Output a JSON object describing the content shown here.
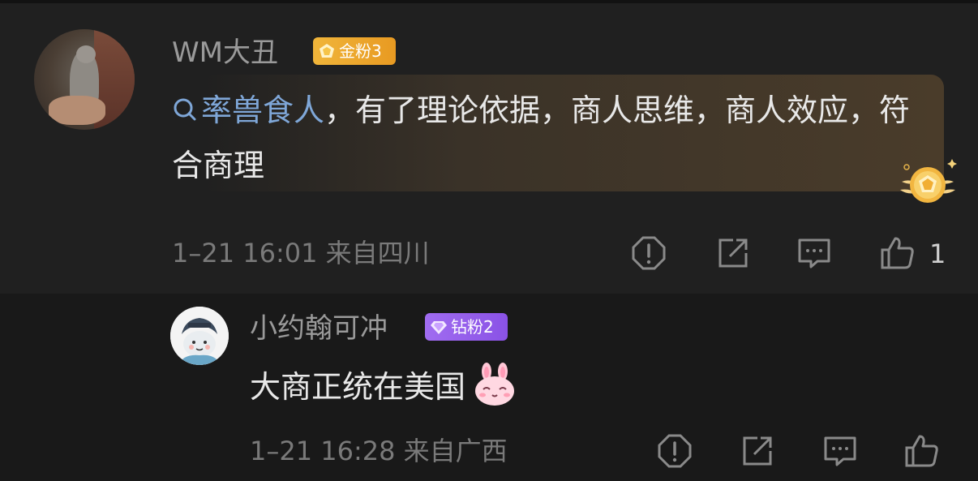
{
  "comment": {
    "username": "WM大丑",
    "badge": "金粉3",
    "search_term": "率兽食人",
    "text": "，有了理论依据，商人思维，商人效应，符合商理",
    "time": "1–21 16:01",
    "location": "来自四川",
    "like_count": "1",
    "badge_color": "#f0b53a",
    "link_color": "#7fa7d8"
  },
  "reply": {
    "username": "小约翰可冲",
    "badge": "钻粉2",
    "text": "大商正统在美国",
    "time": "1–21 16:28",
    "location": "来自广西",
    "badge_color": "#9a62ec"
  },
  "icons": [
    "report-icon",
    "share-icon",
    "comment-icon",
    "like-icon",
    "search-icon",
    "rabbit-emoji"
  ]
}
